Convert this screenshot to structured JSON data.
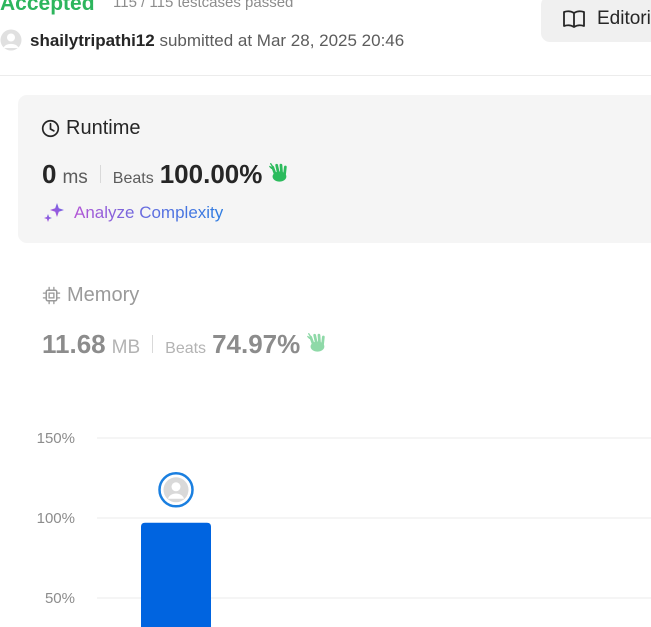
{
  "header": {
    "status": "Accepted",
    "testcases": "115 / 115 testcases passed",
    "editorial_label": "Editorial",
    "username": "shailytripathi12",
    "submitted_text": "submitted at Mar 28, 2025 20:46"
  },
  "runtime": {
    "title": "Runtime",
    "value": "0",
    "unit": "ms",
    "beats_label": "Beats",
    "beats_value": "100.00%",
    "analyze_label": "Analyze Complexity"
  },
  "memory": {
    "title": "Memory",
    "value": "11.68",
    "unit": "MB",
    "beats_label": "Beats",
    "beats_value": "74.97%"
  },
  "colors": {
    "accepted": "#2db55d",
    "bar": "#0064e0",
    "clap": "#2cbb5d",
    "clap_muted": "#8fd9a8"
  },
  "chart_data": {
    "type": "bar",
    "ytick_labels": [
      "150%",
      "100%",
      "50%"
    ],
    "yticks": [
      150,
      100,
      50
    ],
    "ylim": [
      30,
      160
    ],
    "bars": [
      {
        "value": 97,
        "marker": "user-avatar"
      }
    ],
    "grid": true
  }
}
